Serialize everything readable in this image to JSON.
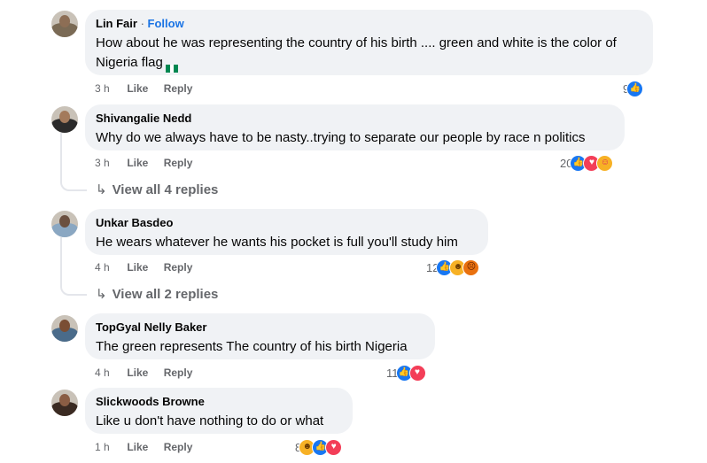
{
  "comments": [
    {
      "author": "Lin Fair",
      "separator": "·",
      "follow": "Follow",
      "text": "How about he was representing the country of his birth .... green and white is the color of Nigeria flag",
      "time": "3 h",
      "like": "Like",
      "reply": "Reply",
      "reaction_count": "9",
      "reactions": [
        "like"
      ],
      "emoji": "nigeria-flag"
    },
    {
      "author": "Shivangalie Nedd",
      "text": "Why do we always have to be nasty..trying to separate our people by race n politics",
      "time": "3 h",
      "like": "Like",
      "reply": "Reply",
      "reaction_count": "20",
      "reactions": [
        "like",
        "love",
        "care"
      ],
      "view_replies": "View all 4 replies"
    },
    {
      "author": "Unkar Basdeo",
      "text": "He wears whatever he wants his pocket is full you'll study him",
      "time": "4 h",
      "like": "Like",
      "reply": "Reply",
      "reaction_count": "12",
      "reactions": [
        "like",
        "haha",
        "angry"
      ],
      "view_replies": "View all 2 replies"
    },
    {
      "author": "TopGyal Nelly Baker",
      "text": "The green represents The country of his birth Nigeria",
      "time": "4 h",
      "like": "Like",
      "reply": "Reply",
      "reaction_count": "11",
      "reactions": [
        "like",
        "love"
      ]
    },
    {
      "author": "Slickwoods Browne",
      "text": "Like u don't have nothing to do or what",
      "time": "1 h",
      "like": "Like",
      "reply": "Reply",
      "reaction_count": "8",
      "reactions": [
        "haha",
        "like",
        "love"
      ]
    }
  ],
  "colors": {
    "bubble": "#f0f2f5",
    "link_blue": "#1b74e4",
    "meta_gray": "#65676b",
    "like_blue": "#1877f2",
    "love_red": "#f33e58",
    "nigeria_green": "#008751"
  }
}
